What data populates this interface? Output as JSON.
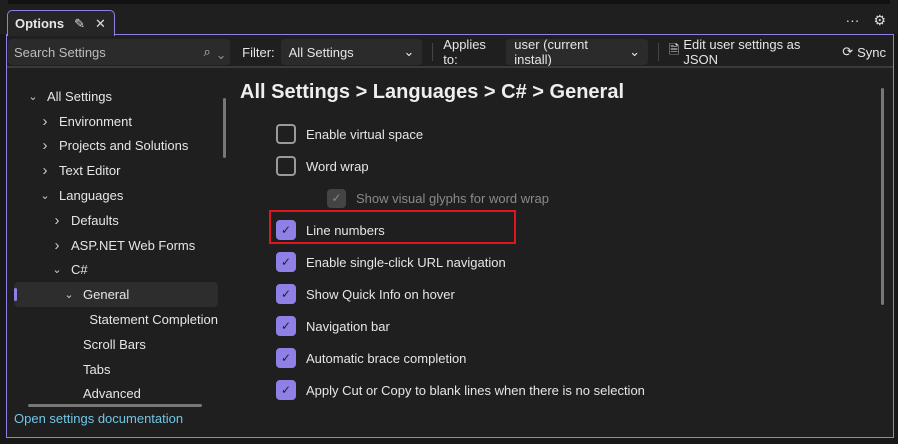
{
  "tab": {
    "title": "Options",
    "pin_icon": "pin-icon",
    "close_icon": "close-icon"
  },
  "top_actions": {
    "more": "···",
    "settings_icon": "gear-icon"
  },
  "toolbar": {
    "search_placeholder": "Search Settings",
    "filter_label": "Filter:",
    "filter_value": "All Settings",
    "applies_label": "Applies to:",
    "applies_value": "user (current install)",
    "edit_json": "Edit user settings as JSON",
    "sync": "Sync"
  },
  "tree": [
    {
      "label": "All Settings",
      "level": 0,
      "chevron": "down"
    },
    {
      "label": "Environment",
      "level": 1,
      "chevron": "right"
    },
    {
      "label": "Projects and Solutions",
      "level": 1,
      "chevron": "right"
    },
    {
      "label": "Text Editor",
      "level": 1,
      "chevron": "right"
    },
    {
      "label": "Languages",
      "level": 1,
      "chevron": "down"
    },
    {
      "label": "Defaults",
      "level": 2,
      "chevron": "right"
    },
    {
      "label": "ASP.NET Web Forms",
      "level": 2,
      "chevron": "right"
    },
    {
      "label": "C#",
      "level": 2,
      "chevron": "down"
    },
    {
      "label": "General",
      "level": 3,
      "chevron": "down",
      "selected": true
    },
    {
      "label": "Statement Completion",
      "level": 4,
      "chevron": ""
    },
    {
      "label": "Scroll Bars",
      "level": 3,
      "chevron": ""
    },
    {
      "label": "Tabs",
      "level": 3,
      "chevron": ""
    },
    {
      "label": "Advanced",
      "level": 3,
      "chevron": ""
    }
  ],
  "doc_link": "Open settings documentation",
  "heading": "All Settings > Languages > C# > General",
  "options": [
    {
      "label": "Enable virtual space",
      "checked": false
    },
    {
      "label": "Word wrap",
      "checked": false
    },
    {
      "label": "Show visual glyphs for word wrap",
      "checked": true,
      "disabled": true
    },
    {
      "label": "Line numbers",
      "checked": true
    },
    {
      "label": "Enable single-click URL navigation",
      "checked": true
    },
    {
      "label": "Show Quick Info on hover",
      "checked": true
    },
    {
      "label": "Navigation bar",
      "checked": true
    },
    {
      "label": "Automatic brace completion",
      "checked": true
    },
    {
      "label": "Apply Cut or Copy to blank lines when there is no selection",
      "checked": true
    }
  ],
  "colors": {
    "accent": "#8f80e8",
    "highlight": "#e0161f",
    "link": "#71c6e8"
  }
}
